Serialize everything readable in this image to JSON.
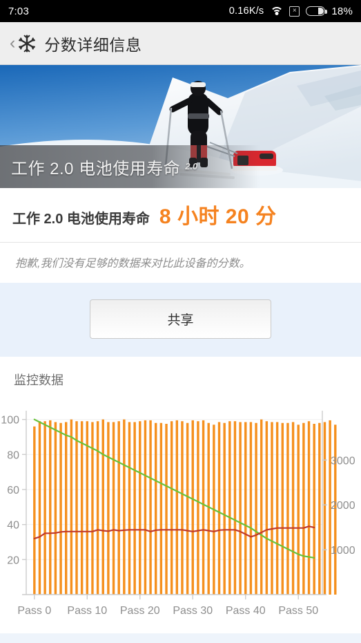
{
  "statusbar": {
    "time": "7:03",
    "network_speed": "0.16K/s",
    "wifi_icon": "wifi-icon",
    "nosim_icon": "no-sim-icon",
    "nosim_glyph": "×",
    "battery_icon": "battery-icon",
    "battery_percent": "18%"
  },
  "appbar": {
    "back_glyph": "‹",
    "logo_icon": "snowflake-logo-icon",
    "title": "分数详细信息"
  },
  "hero": {
    "caption": "工作 2.0 电池使用寿命",
    "version": "2.0",
    "image_alt": "skier-pulling-red-sled-on-snow"
  },
  "score": {
    "label": "工作 2.0 电池使用寿命",
    "value": "8 小时 20 分",
    "value_color": "#f5821f"
  },
  "note": {
    "text": "抱歉,我们没有足够的数据来对比此设备的分数。"
  },
  "share": {
    "label": "共享"
  },
  "monitor": {
    "title": "监控数据"
  },
  "chart_data": {
    "type": "bar",
    "title": "",
    "xlabel": "",
    "ylabel": "",
    "y_left_label": "",
    "y_right_label": "",
    "grid": true,
    "legend": "none",
    "x_tick_labels": [
      "Pass 0",
      "Pass 10",
      "Pass 20",
      "Pass 30",
      "Pass 40",
      "Pass 50"
    ],
    "x_tick_indices": [
      0,
      10,
      20,
      30,
      40,
      50
    ],
    "y_left_ticks": [
      20,
      40,
      60,
      80,
      100
    ],
    "y_left_lim": [
      0,
      105
    ],
    "y_right_ticks": [
      1000,
      2000,
      3000
    ],
    "y_right_lim": [
      0,
      4100
    ],
    "colors": {
      "bars": "#f5901e",
      "battery_line": "#67c23a",
      "temperature_line": "#c0392b"
    },
    "categories": [
      "Pass 0",
      "Pass 1",
      "Pass 2",
      "Pass 3",
      "Pass 4",
      "Pass 5",
      "Pass 6",
      "Pass 7",
      "Pass 8",
      "Pass 9",
      "Pass 10",
      "Pass 11",
      "Pass 12",
      "Pass 13",
      "Pass 14",
      "Pass 15",
      "Pass 16",
      "Pass 17",
      "Pass 18",
      "Pass 19",
      "Pass 20",
      "Pass 21",
      "Pass 22",
      "Pass 23",
      "Pass 24",
      "Pass 25",
      "Pass 26",
      "Pass 27",
      "Pass 28",
      "Pass 29",
      "Pass 30",
      "Pass 31",
      "Pass 32",
      "Pass 33",
      "Pass 34",
      "Pass 35",
      "Pass 36",
      "Pass 37",
      "Pass 38",
      "Pass 39",
      "Pass 40",
      "Pass 41",
      "Pass 42",
      "Pass 43",
      "Pass 44",
      "Pass 45",
      "Pass 46",
      "Pass 47",
      "Pass 48",
      "Pass 49",
      "Pass 50",
      "Pass 51",
      "Pass 52",
      "Pass 53"
    ],
    "series": [
      {
        "name": "performance-bars",
        "axis": "left",
        "type": "bar",
        "color": "#f5901e",
        "values": [
          96,
          99,
          99,
          99.5,
          98.5,
          98,
          98.5,
          100,
          99,
          99,
          99,
          98.5,
          99,
          100,
          98.5,
          98.5,
          99,
          100,
          98.5,
          98.5,
          99,
          99.5,
          99.5,
          98,
          98,
          97.5,
          99,
          99.5,
          99,
          98,
          99.5,
          99,
          99.5,
          98,
          97,
          98.5,
          98,
          99,
          99,
          98.5,
          98.5,
          98.5,
          98,
          100,
          99,
          98.5,
          98.5,
          98,
          98,
          98.5,
          97,
          98,
          99,
          97.5,
          98,
          98.5,
          99.5,
          97
        ]
      },
      {
        "name": "battery-level-line",
        "axis": "left",
        "type": "line",
        "color": "#67c23a",
        "values": [
          100,
          98.5,
          97,
          95.5,
          94,
          92.5,
          91,
          90,
          88,
          86.5,
          85,
          83.5,
          82,
          80,
          78.5,
          77,
          75.5,
          74,
          72.5,
          71,
          69.5,
          68,
          66.5,
          65,
          63.5,
          62,
          60.5,
          59,
          57.5,
          56,
          54.5,
          53,
          51.5,
          50,
          48.5,
          47,
          45.5,
          44,
          42.5,
          41,
          39.5,
          38,
          36,
          34,
          32,
          30.5,
          29,
          27.5,
          26,
          24.5,
          23,
          22,
          21.5,
          21
        ]
      },
      {
        "name": "temperature-line",
        "axis": "left",
        "type": "line",
        "color": "#c0392b",
        "values": [
          32,
          33,
          35,
          35,
          35.2,
          35.8,
          36,
          36,
          36,
          36,
          36,
          36,
          37,
          36.5,
          36.2,
          37,
          36.5,
          36.8,
          37,
          37,
          37,
          37,
          36,
          36.8,
          37,
          37,
          37,
          37,
          37,
          36.5,
          36,
          36.5,
          37,
          36.5,
          36,
          36.8,
          37,
          37,
          37,
          36,
          34.5,
          33,
          34,
          35.5,
          37,
          37.5,
          38,
          38,
          38,
          38,
          38,
          38,
          39,
          38.3
        ]
      }
    ]
  }
}
